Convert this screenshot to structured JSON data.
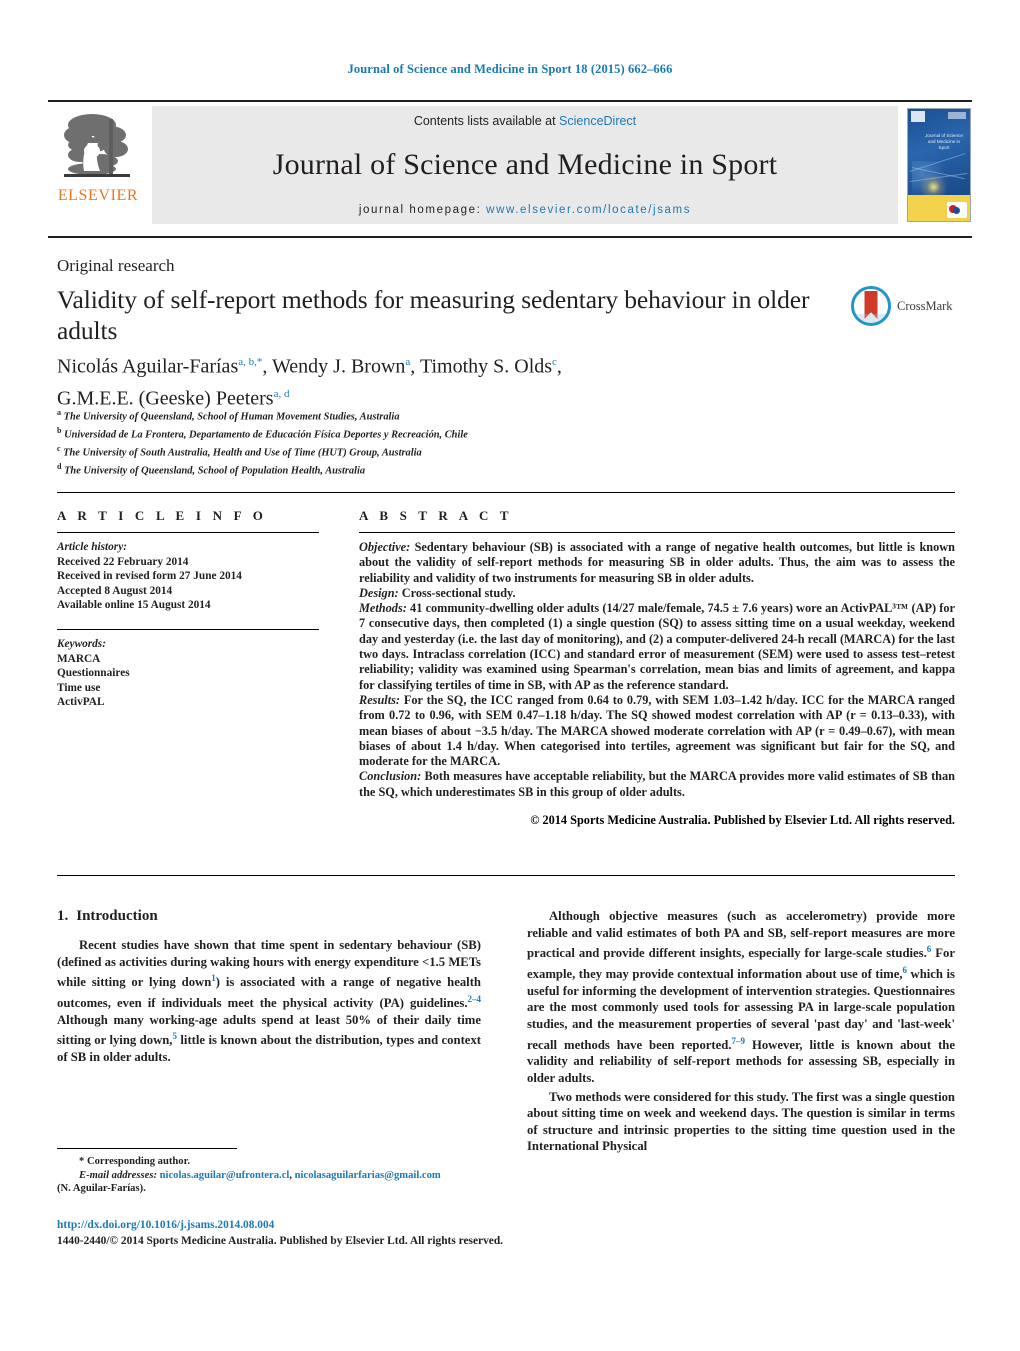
{
  "running_head": "Journal of Science and Medicine in Sport 18 (2015) 662–666",
  "masthead": {
    "publisher_name": "ELSEVIER",
    "contents_prefix": "Contents lists available at",
    "contents_link": "ScienceDirect",
    "journal_title": "Journal of Science and Medicine in Sport",
    "homepage_label": "journal homepage:",
    "homepage_url": "www.elsevier.com/locate/jsams",
    "cover": {
      "title": "Journal of Science and Medicine in Sport",
      "publisher_mark": "ELSEVIER"
    }
  },
  "article": {
    "type": "Original research",
    "title": "Validity of self-report methods for measuring sedentary behaviour in older adults",
    "crossmark_label": "CrossMark",
    "authors_line1": "Nicolás Aguilar-Farías",
    "authors_line1_sup": "a, b,",
    "authors_line1_star": "*",
    "author2": "Wendy J. Brown",
    "author2_sup": "a",
    "author3": "Timothy S. Olds",
    "author3_sup": "c",
    "author4": "G.M.E.E. (Geeske) Peeters",
    "author4_sup": "a, d",
    "affiliations": [
      {
        "mark": "a",
        "text": "The University of Queensland, School of Human Movement Studies, Australia"
      },
      {
        "mark": "b",
        "text": "Universidad de La Frontera, Departamento de Educación Física Deportes y Recreación, Chile"
      },
      {
        "mark": "c",
        "text": "The University of South Australia, Health and Use of Time (HUT) Group, Australia"
      },
      {
        "mark": "d",
        "text": "The University of Queensland, School of Population Health, Australia"
      }
    ]
  },
  "article_info": {
    "heading": "A R T I C L E    I N F O",
    "history_label": "Article history:",
    "history": [
      "Received 22 February 2014",
      "Received in revised form 27 June 2014",
      "Accepted 8 August 2014",
      "Available online 15 August 2014"
    ],
    "keywords_label": "Keywords:",
    "keywords": [
      "MARCA",
      "Questionnaires",
      "Time use",
      "ActivPAL"
    ]
  },
  "abstract": {
    "heading": "A B S T R A C T",
    "objective_label": "Objective:",
    "objective_text": " Sedentary behaviour (SB) is associated with a range of negative health outcomes, but little is known about the validity of self-report methods for measuring SB in older adults. Thus, the aim was to assess the reliability and validity of two instruments for measuring SB in older adults.",
    "design_label": "Design:",
    "design_text": " Cross-sectional study.",
    "methods_label": "Methods:",
    "methods_text": " 41 community-dwelling older adults (14/27 male/female, 74.5 ± 7.6 years) wore an ActivPAL³™ (AP) for 7 consecutive days, then completed (1) a single question (SQ) to assess sitting time on a usual weekday, weekend day and yesterday (i.e. the last day of monitoring), and (2) a computer-delivered 24-h recall (MARCA) for the last two days. Intraclass correlation (ICC) and standard error of measurement (SEM) were used to assess test–retest reliability; validity was examined using Spearman's correlation, mean bias and limits of agreement, and kappa for classifying tertiles of time in SB, with AP as the reference standard.",
    "results_label": "Results:",
    "results_text": " For the SQ, the ICC ranged from 0.64 to 0.79, with SEM 1.03–1.42 h/day. ICC for the MARCA ranged from 0.72 to 0.96, with SEM 0.47–1.18 h/day. The SQ showed modest correlation with AP (r = 0.13–0.33), with mean biases of about −3.5 h/day. The MARCA showed moderate correlation with AP (r = 0.49–0.67), with mean biases of about 1.4 h/day. When categorised into tertiles, agreement was significant but fair for the SQ, and moderate for the MARCA.",
    "conclusion_label": "Conclusion:",
    "conclusion_text": " Both measures have acceptable reliability, but the MARCA provides more valid estimates of SB than the SQ, which underestimates SB in this group of older adults.",
    "copyright": "© 2014 Sports Medicine Australia. Published by Elsevier Ltd. All rights reserved."
  },
  "body": {
    "section_number": "1.",
    "section_title": "Introduction",
    "left_paragraphs": [
      {
        "p1": "Recent studies have shown that time spent in sedentary behaviour (SB) (defined as activities during waking hours with energy expenditure <1.5 METs while sitting or lying down",
        "r1": "1",
        "p2": ") is associated with a range of negative health outcomes, even if individuals meet the physical activity (PA) guidelines.",
        "r2": "2–4",
        "p3": " Although many working-age adults spend at least 50% of their daily time sitting or lying down,",
        "r3": "5",
        "p4": " little is known about the distribution, types and context of SB in older adults."
      }
    ],
    "right_paragraphs": [
      {
        "p1": "Although objective measures (such as accelerometry) provide more reliable and valid estimates of both PA and SB, self-report measures are more practical and provide different insights, especially for large-scale studies.",
        "r1": "6",
        "p2": " For example, they may provide contextual information about use of time,",
        "r2": "6",
        "p3": " which is useful for informing the development of intervention strategies. Questionnaires are the most commonly used tools for assessing PA in large-scale population studies, and the measurement properties of several 'past day' and 'last-week' recall methods have been reported.",
        "r3": "7–9",
        "p4": " However, little is known about the validity and reliability of self-report methods for assessing SB, especially in older adults."
      },
      {
        "p1": "Two methods were considered for this study. The first was a single question about sitting time on week and weekend days. The question is similar in terms of structure and intrinsic properties to the sitting time question used in the International Physical",
        "r1": "",
        "p2": "",
        "r2": "",
        "p3": "",
        "r3": "",
        "p4": ""
      }
    ]
  },
  "footnote": {
    "star": "*",
    "corresponding": " Corresponding author.",
    "email_label": "E-mail addresses:",
    "email1": "nicolas.aguilar@ufrontera.cl",
    "email_sep": ", ",
    "email2": "nicolasaguilarfarias@gmail.com",
    "email_author": "(N. Aguilar-Farías)."
  },
  "doi": {
    "url": "http://dx.doi.org/10.1016/j.jsams.2014.08.004",
    "issn_line": "1440-2440/© 2014 Sports Medicine Australia. Published by Elsevier Ltd. All rights reserved."
  },
  "colors": {
    "link": "#1a7ab5",
    "elsevier_orange": "#e87722",
    "crossmark_blue": "#2196c9",
    "crossmark_red": "#cf3a2a",
    "band_gray": "#e9e9e9"
  }
}
